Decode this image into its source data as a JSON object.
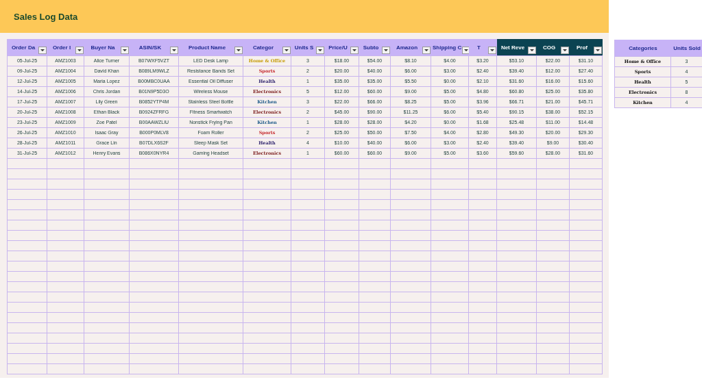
{
  "title": "Sales Log Data",
  "sales_table": {
    "columns": [
      {
        "label": "Order Da",
        "kind": "input",
        "filter": true
      },
      {
        "label": "Order I",
        "kind": "input",
        "filter": true
      },
      {
        "label": "Buyer Na",
        "kind": "input",
        "filter": true
      },
      {
        "label": "ASIN/SK",
        "kind": "input",
        "filter": true
      },
      {
        "label": "Product Name",
        "kind": "input",
        "filter": true
      },
      {
        "label": "Categor",
        "kind": "input",
        "filter": true
      },
      {
        "label": "Units S",
        "kind": "input",
        "filter": true
      },
      {
        "label": "Price/U",
        "kind": "input",
        "filter": true
      },
      {
        "label": "Subto",
        "kind": "input",
        "filter": true
      },
      {
        "label": "Amazon",
        "kind": "input",
        "filter": true
      },
      {
        "label": "Shipping C",
        "kind": "input",
        "filter": true
      },
      {
        "label": "T",
        "kind": "input",
        "filter": true
      },
      {
        "label": "Net Reve",
        "kind": "result",
        "filter": true
      },
      {
        "label": "COG",
        "kind": "result",
        "filter": true
      },
      {
        "label": "Prof",
        "kind": "result",
        "filter": true
      }
    ],
    "rows": [
      {
        "cells": [
          {
            "text": "05-Jul-25"
          },
          {
            "text": "AMZ1003"
          },
          {
            "text": "Alice Turner"
          },
          {
            "text": "B07WXF5VZT"
          },
          {
            "text": "LED Desk Lamp"
          },
          {
            "text": "Home & Office",
            "color": "#c79d0a"
          },
          {
            "text": "3"
          },
          {
            "text": "$18.00"
          },
          {
            "text": "$54.00"
          },
          {
            "text": "$8.10"
          },
          {
            "text": "$4.00"
          },
          {
            "text": "$3.20"
          },
          {
            "text": "$53.10"
          },
          {
            "text": "$22.00"
          },
          {
            "text": "$31.10"
          }
        ]
      },
      {
        "cells": [
          {
            "text": "09-Jul-25"
          },
          {
            "text": "AMZ1004"
          },
          {
            "text": "David Khan"
          },
          {
            "text": "B089LM9WLZ"
          },
          {
            "text": "Resistance Bands Set"
          },
          {
            "text": "Sports",
            "color": "#c4262b"
          },
          {
            "text": "2"
          },
          {
            "text": "$20.00"
          },
          {
            "text": "$40.00"
          },
          {
            "text": "$6.00"
          },
          {
            "text": "$3.00"
          },
          {
            "text": "$2.40"
          },
          {
            "text": "$39.40"
          },
          {
            "text": "$12.00"
          },
          {
            "text": "$27.40"
          }
        ]
      },
      {
        "cells": [
          {
            "text": "12-Jul-25"
          },
          {
            "text": "AMZ1005"
          },
          {
            "text": "Maria Lopez"
          },
          {
            "text": "B00MBC0UAA"
          },
          {
            "text": "Essential Oil Diffuser"
          },
          {
            "text": "Health",
            "color": "#2a1f6b"
          },
          {
            "text": "1"
          },
          {
            "text": "$35.00"
          },
          {
            "text": "$35.00"
          },
          {
            "text": "$5.50"
          },
          {
            "text": "$0.00"
          },
          {
            "text": "$2.10"
          },
          {
            "text": "$31.60"
          },
          {
            "text": "$16.00"
          },
          {
            "text": "$15.60"
          }
        ]
      },
      {
        "cells": [
          {
            "text": "14-Jul-25"
          },
          {
            "text": "AMZ1006"
          },
          {
            "text": "Chris Jordan"
          },
          {
            "text": "B01N9P5D3O"
          },
          {
            "text": "Wireless Mouse"
          },
          {
            "text": "Electronics",
            "color": "#7e2020"
          },
          {
            "text": "5"
          },
          {
            "text": "$12.00"
          },
          {
            "text": "$60.00"
          },
          {
            "text": "$9.00"
          },
          {
            "text": "$5.00"
          },
          {
            "text": "$4.80"
          },
          {
            "text": "$60.80"
          },
          {
            "text": "$25.00"
          },
          {
            "text": "$35.80"
          }
        ]
      },
      {
        "cells": [
          {
            "text": "17-Jul-25"
          },
          {
            "text": "AMZ1007"
          },
          {
            "text": "Lily Green"
          },
          {
            "text": "B0852YTP4M"
          },
          {
            "text": "Stainless Steel Bottle"
          },
          {
            "text": "Kitchen",
            "color": "#1d5a88"
          },
          {
            "text": "3"
          },
          {
            "text": "$22.00"
          },
          {
            "text": "$66.00"
          },
          {
            "text": "$8.25"
          },
          {
            "text": "$5.00"
          },
          {
            "text": "$3.96"
          },
          {
            "text": "$66.71"
          },
          {
            "text": "$21.00"
          },
          {
            "text": "$45.71"
          }
        ]
      },
      {
        "cells": [
          {
            "text": "20-Jul-25"
          },
          {
            "text": "AMZ1008"
          },
          {
            "text": "Ethan Black"
          },
          {
            "text": "B0924ZFRFG"
          },
          {
            "text": "Fitness Smartwatch"
          },
          {
            "text": "Electronics",
            "color": "#7e2020"
          },
          {
            "text": "2"
          },
          {
            "text": "$45.00"
          },
          {
            "text": "$90.00"
          },
          {
            "text": "$11.25"
          },
          {
            "text": "$6.00"
          },
          {
            "text": "$5.40"
          },
          {
            "text": "$90.15"
          },
          {
            "text": "$38.00"
          },
          {
            "text": "$52.15"
          }
        ]
      },
      {
        "cells": [
          {
            "text": "23-Jul-25"
          },
          {
            "text": "AMZ1009"
          },
          {
            "text": "Zoe Patel"
          },
          {
            "text": "B00AAWZLIU"
          },
          {
            "text": "Nonstick Frying Pan"
          },
          {
            "text": "Kitchen",
            "color": "#1d5a88"
          },
          {
            "text": "1"
          },
          {
            "text": "$28.00"
          },
          {
            "text": "$28.00"
          },
          {
            "text": "$4.20"
          },
          {
            "text": "$0.00"
          },
          {
            "text": "$1.68"
          },
          {
            "text": "$25.48"
          },
          {
            "text": "$11.00"
          },
          {
            "text": "$14.48"
          }
        ]
      },
      {
        "cells": [
          {
            "text": "26-Jul-25"
          },
          {
            "text": "AMZ1010"
          },
          {
            "text": "Isaac Gray"
          },
          {
            "text": "B000P0MLV8"
          },
          {
            "text": "Foam Roller"
          },
          {
            "text": "Sports",
            "color": "#c4262b"
          },
          {
            "text": "2"
          },
          {
            "text": "$25.00"
          },
          {
            "text": "$50.00"
          },
          {
            "text": "$7.50"
          },
          {
            "text": "$4.00"
          },
          {
            "text": "$2.80"
          },
          {
            "text": "$49.30"
          },
          {
            "text": "$20.00"
          },
          {
            "text": "$29.30"
          }
        ]
      },
      {
        "cells": [
          {
            "text": "28-Jul-25"
          },
          {
            "text": "AMZ1011"
          },
          {
            "text": "Grace Lin"
          },
          {
            "text": "B07DLX6S2F"
          },
          {
            "text": "Sleep Mask Set"
          },
          {
            "text": "Health",
            "color": "#2a1f6b"
          },
          {
            "text": "4"
          },
          {
            "text": "$10.00"
          },
          {
            "text": "$40.00"
          },
          {
            "text": "$6.00"
          },
          {
            "text": "$3.00"
          },
          {
            "text": "$2.40"
          },
          {
            "text": "$39.40"
          },
          {
            "text": "$9.00"
          },
          {
            "text": "$30.40"
          }
        ]
      },
      {
        "cells": [
          {
            "text": "31-Jul-25"
          },
          {
            "text": "AMZ1012"
          },
          {
            "text": "Henry Evans"
          },
          {
            "text": "B086X0NYR4"
          },
          {
            "text": "Gaming Headset"
          },
          {
            "text": "Electronics",
            "color": "#7e2020"
          },
          {
            "text": "1"
          },
          {
            "text": "$60.00"
          },
          {
            "text": "$60.00"
          },
          {
            "text": "$9.00"
          },
          {
            "text": "$5.00"
          },
          {
            "text": "$3.60"
          },
          {
            "text": "$59.60"
          },
          {
            "text": "$28.00"
          },
          {
            "text": "$31.60"
          }
        ]
      }
    ]
  },
  "summary_table": {
    "columns": [
      "Categories",
      "Units Sold"
    ],
    "rows": [
      {
        "category": "Home & Office",
        "units_sold": "3"
      },
      {
        "category": "Sports",
        "units_sold": "4"
      },
      {
        "category": "Health",
        "units_sold": "5"
      },
      {
        "category": "Electronics",
        "units_sold": "8"
      },
      {
        "category": "Kitchen",
        "units_sold": "4"
      }
    ]
  }
}
